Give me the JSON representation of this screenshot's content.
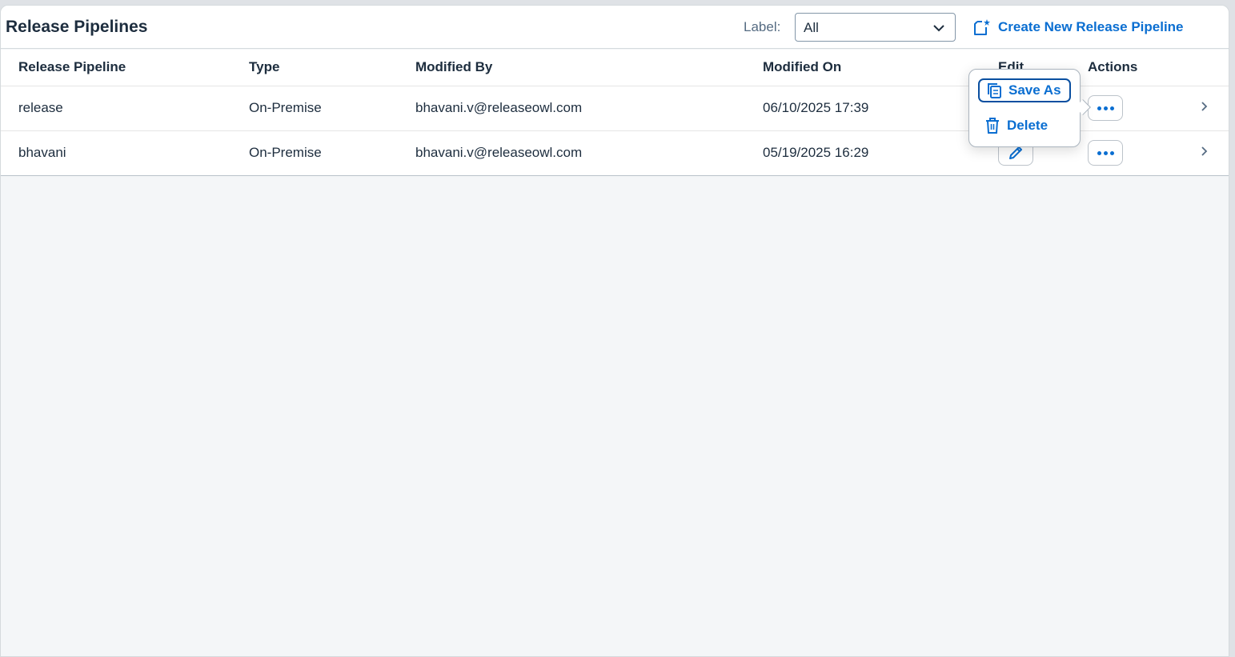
{
  "page": {
    "title": "Release Pipelines",
    "label_caption": "Label:",
    "label_select_value": "All",
    "create_button_label": "Create New Release Pipeline"
  },
  "table": {
    "columns": [
      "Release Pipeline",
      "Type",
      "Modified By",
      "Modified On",
      "Edit",
      "Actions"
    ],
    "rows": [
      {
        "name": "release",
        "type": "On-Premise",
        "modified_by": "bhavani.v@releaseowl.com",
        "modified_on": "06/10/2025 17:39"
      },
      {
        "name": "bhavani",
        "type": "On-Premise",
        "modified_by": "bhavani.v@releaseowl.com",
        "modified_on": "05/19/2025 16:29"
      }
    ]
  },
  "popover": {
    "items": [
      {
        "label": "Save As",
        "icon": "copy-icon"
      },
      {
        "label": "Delete",
        "icon": "trash-icon"
      }
    ]
  },
  "colors": {
    "accent": "#0a6ed1",
    "text": "#1d2d3e",
    "background": "#f4f6f8"
  }
}
